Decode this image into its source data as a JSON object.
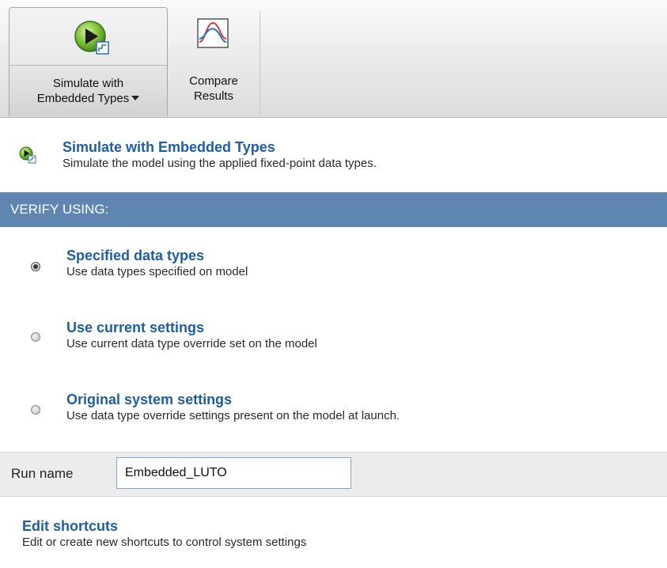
{
  "toolstrip": {
    "simulate_button": {
      "line1": "Simulate with",
      "line2": "Embedded Types"
    },
    "compare_button": {
      "line1": "Compare",
      "line2": "Results"
    }
  },
  "header_item": {
    "title": "Simulate with Embedded Types",
    "description": "Simulate the model using the applied fixed-point data types.",
    "icon": "run-embedded-icon"
  },
  "section": {
    "label": "VERIFY USING:"
  },
  "options": [
    {
      "title": "Specified data types",
      "description": "Use data types specified on model",
      "selected": true
    },
    {
      "title": "Use current settings",
      "description": "Use current data type override set on the model",
      "selected": false
    },
    {
      "title": "Original system settings",
      "description": "Use data type override settings present on the model at launch.",
      "selected": false
    }
  ],
  "run_name": {
    "label": "Run name",
    "value": "Embedded_LUTO"
  },
  "shortcuts": {
    "title": "Edit shortcuts",
    "description": "Edit or create new shortcuts to control system settings"
  },
  "colors": {
    "link": "#1f5da6",
    "section_header": "#5f86b3",
    "input_border": "#7aa6d1"
  }
}
